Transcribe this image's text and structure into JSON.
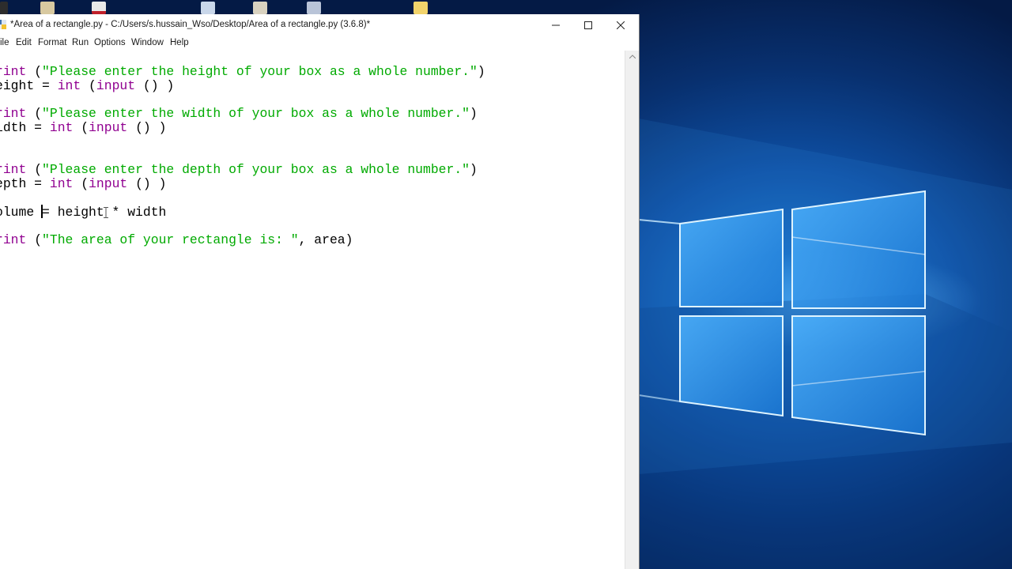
{
  "window": {
    "title": "*Area of a rectangle.py - C:/Users/s.hussain_Wso/Desktop/Area of a rectangle.py (3.6.8)*"
  },
  "menu": [
    "ile",
    "Edit",
    "Format",
    "Run",
    "Options",
    "Window",
    "Help"
  ],
  "code": {
    "lines": [
      [
        {
          "t": "rint ",
          "c": "kw"
        },
        {
          "t": "(",
          "c": "tx"
        },
        {
          "t": "\"Please enter the height of your box as a whole number.\"",
          "c": "st"
        },
        {
          "t": ")",
          "c": "tx"
        }
      ],
      [
        {
          "t": "eight = ",
          "c": "tx"
        },
        {
          "t": "int",
          "c": "kw"
        },
        {
          "t": " (",
          "c": "tx"
        },
        {
          "t": "input",
          "c": "kw"
        },
        {
          "t": " () )",
          "c": "tx"
        }
      ],
      [],
      [
        {
          "t": "rint ",
          "c": "kw"
        },
        {
          "t": "(",
          "c": "tx"
        },
        {
          "t": "\"Please enter the width of your box as a whole number.\"",
          "c": "st"
        },
        {
          "t": ")",
          "c": "tx"
        }
      ],
      [
        {
          "t": "idth = ",
          "c": "tx"
        },
        {
          "t": "int",
          "c": "kw"
        },
        {
          "t": " (",
          "c": "tx"
        },
        {
          "t": "input",
          "c": "kw"
        },
        {
          "t": " () )",
          "c": "tx"
        }
      ],
      [],
      [],
      [
        {
          "t": "rint ",
          "c": "kw"
        },
        {
          "t": "(",
          "c": "tx"
        },
        {
          "t": "\"Please enter the depth of your box as a whole number.\"",
          "c": "st"
        },
        {
          "t": ")",
          "c": "tx"
        }
      ],
      [
        {
          "t": "epth = ",
          "c": "tx"
        },
        {
          "t": "int",
          "c": "kw"
        },
        {
          "t": " (",
          "c": "tx"
        },
        {
          "t": "input",
          "c": "kw"
        },
        {
          "t": " () )",
          "c": "tx"
        }
      ],
      [],
      [
        {
          "t": "olume = height * width",
          "c": "tx"
        }
      ],
      [],
      [
        {
          "t": "rint ",
          "c": "kw"
        },
        {
          "t": "(",
          "c": "tx"
        },
        {
          "t": "\"The area of your rectangle is: \"",
          "c": "st"
        },
        {
          "t": ", area)",
          "c": "tx"
        }
      ]
    ]
  },
  "colors": {
    "keyword": "#900090",
    "string": "#00aa00",
    "text": "#000000"
  }
}
